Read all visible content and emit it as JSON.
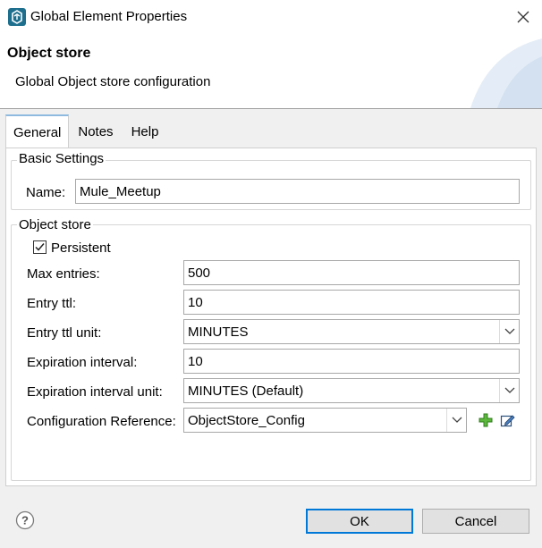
{
  "window": {
    "title": "Global Element Properties"
  },
  "header": {
    "title": "Object store",
    "subtitle": "Global Object store configuration"
  },
  "tabs": [
    {
      "label": "General",
      "active": true
    },
    {
      "label": "Notes",
      "active": false
    },
    {
      "label": "Help",
      "active": false
    }
  ],
  "basic_settings": {
    "legend": "Basic Settings",
    "name_label": "Name:",
    "name_value": "Mule_Meetup"
  },
  "object_store": {
    "legend": "Object store",
    "persistent_label": "Persistent",
    "persistent_checked": true,
    "max_entries_label": "Max entries:",
    "max_entries_value": "500",
    "entry_ttl_label": "Entry ttl:",
    "entry_ttl_value": "10",
    "entry_ttl_unit_label": "Entry ttl unit:",
    "entry_ttl_unit_value": "MINUTES",
    "expiration_interval_label": "Expiration interval:",
    "expiration_interval_value": "10",
    "expiration_interval_unit_label": "Expiration interval unit:",
    "expiration_interval_unit_value": "MINUTES (Default)",
    "config_ref_label": "Configuration Reference:",
    "config_ref_value": "ObjectStore_Config"
  },
  "footer": {
    "ok_label": "OK",
    "cancel_label": "Cancel"
  },
  "icons": {
    "app": "mule-global-element-icon",
    "close": "close-icon",
    "help": "help-icon",
    "add": "add-plus-icon",
    "edit": "edit-icon",
    "dropdown": "chevron-down-icon"
  },
  "colors": {
    "accent": "#0078d7",
    "tab_highlight": "#8fbadf",
    "add_icon": "#3a9a2a",
    "app_icon": "#1e6f8e"
  }
}
